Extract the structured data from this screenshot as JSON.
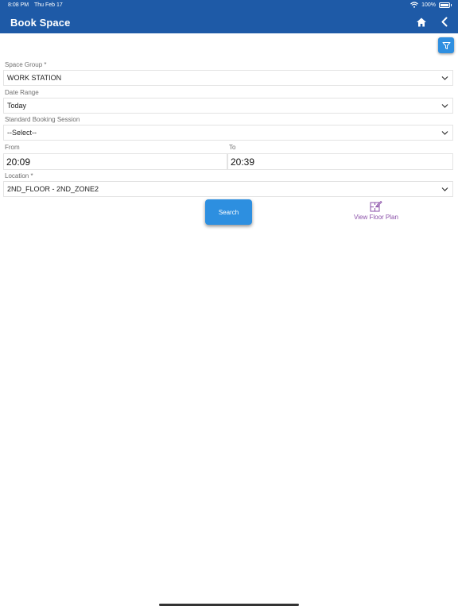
{
  "status_bar": {
    "time": "8:08 PM",
    "date": "Thu Feb 17",
    "battery": "100%"
  },
  "header": {
    "title": "Book Space",
    "home_icon": "home-icon",
    "back_icon": "chevron-left-icon"
  },
  "toolbar": {
    "filter_icon": "filter-icon"
  },
  "form": {
    "space_group": {
      "label": "Space Group *",
      "value": "WORK STATION"
    },
    "date_range": {
      "label": "Date Range",
      "value": "Today"
    },
    "booking_session": {
      "label": "Standard Booking Session",
      "value": "--Select--"
    },
    "from": {
      "label": "From",
      "value": "20:09"
    },
    "to": {
      "label": "To",
      "value": "20:39"
    },
    "location": {
      "label": "Location *",
      "value": "2ND_FLOOR - 2ND_ZONE2"
    }
  },
  "actions": {
    "search_label": "Search",
    "floor_plan_label": "View Floor Plan"
  },
  "colors": {
    "header": "#1e5aa7",
    "accent": "#2d8fe0",
    "link": "#8a4fa8"
  }
}
